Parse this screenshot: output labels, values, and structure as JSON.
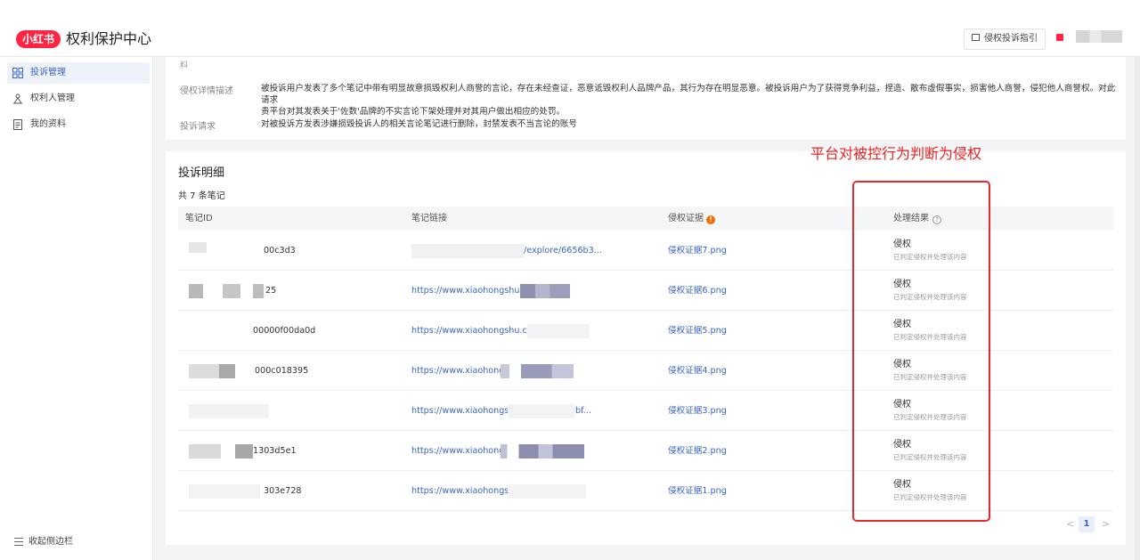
{
  "header": {
    "logo": "小红书",
    "title": "权利保护中心",
    "guide_button": "侵权投诉指引"
  },
  "sidebar": {
    "items": [
      {
        "label": "投诉管理",
        "icon": "grid-icon",
        "active": true
      },
      {
        "label": "权利人管理",
        "icon": "person-tree-icon",
        "active": false
      },
      {
        "label": "我的资料",
        "icon": "document-icon",
        "active": false
      }
    ],
    "collapse": "收起侧边栏"
  },
  "complaint": {
    "cut_label": "料",
    "desc_label": "侵权详情描述",
    "desc_value_line1": "被投诉用户发表了多个笔记中带有明显故意损毁权利人商誉的言论，存在未经查证，恶意诋毁权利人品牌产品，其行为存在明显恶意。被投诉用户为了获得竞争利益，捏造、散布虚假事实，损害他人商誉，侵犯他人商誉权。对此请求",
    "desc_value_line2": "贵平台对其发表关于'佐数'品牌的不实言论下架处理并对其用户做出相应的处罚。",
    "request_label": "投诉请求",
    "request_value": "对被投诉方发表涉嫌损毁投诉人的相关言论笔记进行删除，封禁发表不当言论的账号"
  },
  "details": {
    "title": "投诉明细",
    "count_text": "共 7 条笔记",
    "columns": [
      "笔记ID",
      "笔记链接",
      "侵权证据",
      "处理结果"
    ],
    "rows": [
      {
        "id": "00c3d3",
        "link": "/explore/6656b3...",
        "evidence": "侵权证据7.png",
        "result": "侵权",
        "result_sub": "已判定侵权并处理该内容"
      },
      {
        "id": "25",
        "link": "https://www.xiaohongshu.con",
        "evidence": "侵权证据6.png",
        "result": "侵权",
        "result_sub": "已判定侵权并处理该内容"
      },
      {
        "id": "00000f00da0d",
        "link": "https://www.xiaohongshu.com,",
        "evidence": "侵权证据5.png",
        "result": "侵权",
        "result_sub": "已判定侵权并处理该内容"
      },
      {
        "id": "000c018395",
        "link": "https://www.xiaohongsh",
        "evidence": "侵权证据4.png",
        "result": "侵权",
        "result_sub": "已判定侵权并处理该内容"
      },
      {
        "id": "",
        "link": "https://www.xiaohongsh",
        "link_tail": "bf...",
        "evidence": "侵权证据3.png",
        "result": "侵权",
        "result_sub": "已判定侵权并处理该内容"
      },
      {
        "id": "1303d5e1",
        "link": "https://www.xiaohongsh",
        "evidence": "侵权证据2.png",
        "result": "侵权",
        "result_sub": "已判定侵权并处理该内容"
      },
      {
        "id": "303e728",
        "link": "https://www.xiaohongshu",
        "evidence": "侵权证据1.png",
        "result": "侵权",
        "result_sub": "已判定侵权并处理该内容"
      }
    ]
  },
  "pagination": {
    "current": "1"
  },
  "annotation": {
    "text": "平台对被控行为判断为侵权",
    "color": "#e52b2b"
  },
  "colors": {
    "brand": "#ff2442",
    "link": "#3a64c9",
    "warning": "#f56a00"
  }
}
